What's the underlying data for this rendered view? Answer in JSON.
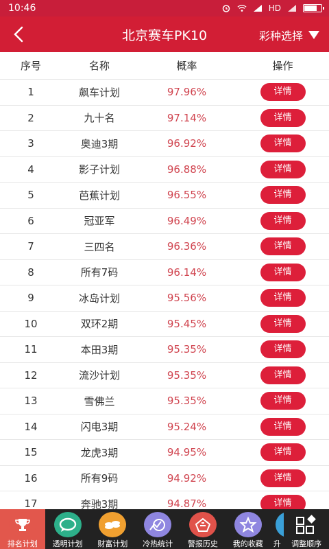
{
  "statusbar": {
    "time": "10:46",
    "network": "HD"
  },
  "header": {
    "title": "北京赛车PK10",
    "variety": "彩种选择"
  },
  "columns": {
    "rank": "序号",
    "name": "名称",
    "rate": "概率",
    "op": "操作"
  },
  "rows": [
    {
      "rank": "1",
      "name": "飙车计划",
      "rate": "97.96%",
      "btn": "详情"
    },
    {
      "rank": "2",
      "name": "九十名",
      "rate": "97.14%",
      "btn": "详情"
    },
    {
      "rank": "3",
      "name": "奥迪3期",
      "rate": "96.92%",
      "btn": "详情"
    },
    {
      "rank": "4",
      "name": "影子计划",
      "rate": "96.88%",
      "btn": "详情"
    },
    {
      "rank": "5",
      "name": "芭蕉计划",
      "rate": "96.55%",
      "btn": "详情"
    },
    {
      "rank": "6",
      "name": "冠亚军",
      "rate": "96.49%",
      "btn": "详情"
    },
    {
      "rank": "7",
      "name": "三四名",
      "rate": "96.36%",
      "btn": "详情"
    },
    {
      "rank": "8",
      "name": "所有7码",
      "rate": "96.14%",
      "btn": "详情"
    },
    {
      "rank": "9",
      "name": "冰岛计划",
      "rate": "95.56%",
      "btn": "详情"
    },
    {
      "rank": "10",
      "name": "双环2期",
      "rate": "95.45%",
      "btn": "详情"
    },
    {
      "rank": "11",
      "name": "本田3期",
      "rate": "95.35%",
      "btn": "详情"
    },
    {
      "rank": "12",
      "name": "流沙计划",
      "rate": "95.35%",
      "btn": "详情"
    },
    {
      "rank": "13",
      "name": "雪佛兰",
      "rate": "95.35%",
      "btn": "详情"
    },
    {
      "rank": "14",
      "name": "闪电3期",
      "rate": "95.24%",
      "btn": "详情"
    },
    {
      "rank": "15",
      "name": "龙虎3期",
      "rate": "94.95%",
      "btn": "详情"
    },
    {
      "rank": "16",
      "name": "所有9码",
      "rate": "94.92%",
      "btn": "详情"
    },
    {
      "rank": "17",
      "name": "奔驰3期",
      "rate": "94.87%",
      "btn": "详情"
    }
  ],
  "tabs": [
    {
      "label": "排名计划",
      "icon": "trophy-icon",
      "color": "#e2574c"
    },
    {
      "label": "透明计划",
      "icon": "chat-icon",
      "color": "#2db08a"
    },
    {
      "label": "财富计划",
      "icon": "coins-icon",
      "color": "#f0a030"
    },
    {
      "label": "冷热统计",
      "icon": "chart-icon",
      "color": "#8f86e0"
    },
    {
      "label": "警报历史",
      "icon": "alarm-icon",
      "color": "#e0524a"
    },
    {
      "label": "我的收藏",
      "icon": "star-icon",
      "color": "#8f86e0"
    },
    {
      "label": "升",
      "icon": "partial-icon",
      "color": "#3aa0d8"
    },
    {
      "label": "调整顺序",
      "icon": "grid-icon",
      "color": "#222222"
    }
  ]
}
